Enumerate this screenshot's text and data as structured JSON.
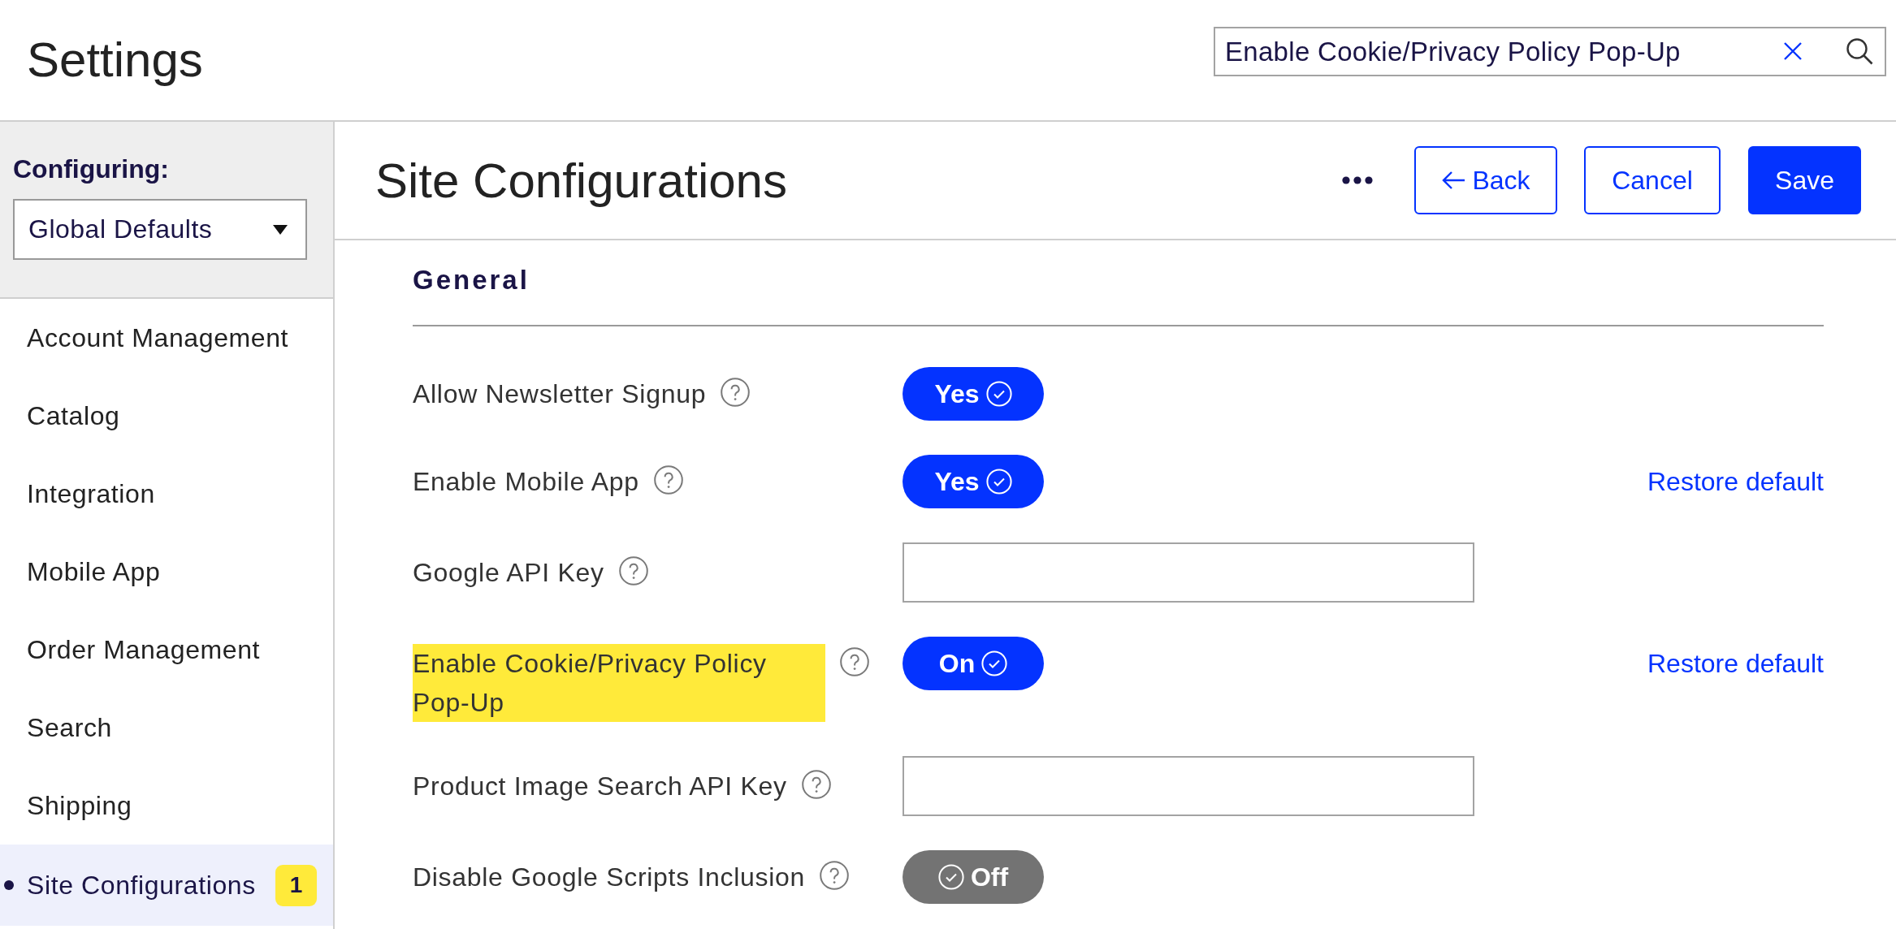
{
  "header": {
    "title": "Settings",
    "search": {
      "value": "Enable Cookie/Privacy Policy Pop-Up"
    }
  },
  "sidebar": {
    "configuring_label": "Configuring:",
    "scope_dropdown": {
      "value": "Global Defaults"
    },
    "items": [
      {
        "label": "Account Management",
        "selected": false
      },
      {
        "label": "Catalog",
        "selected": false
      },
      {
        "label": "Integration",
        "selected": false
      },
      {
        "label": "Mobile App",
        "selected": false
      },
      {
        "label": "Order Management",
        "selected": false
      },
      {
        "label": "Search",
        "selected": false
      },
      {
        "label": "Shipping",
        "selected": false
      },
      {
        "label": "Site Configurations",
        "selected": true,
        "badge": "1"
      }
    ]
  },
  "page": {
    "title": "Site Configurations",
    "actions": [
      {
        "kind": "more"
      },
      {
        "kind": "back",
        "label": "Back"
      },
      {
        "kind": "secondary",
        "label": "Cancel"
      },
      {
        "kind": "primary",
        "label": "Save"
      }
    ]
  },
  "section": {
    "title": "General",
    "rows": [
      {
        "label": "Allow Newsletter Signup",
        "highlighted": false,
        "control": {
          "kind": "toggle",
          "on": true,
          "text": "Yes"
        }
      },
      {
        "label": "Enable Mobile App",
        "highlighted": false,
        "control": {
          "kind": "toggle",
          "on": true,
          "text": "Yes"
        },
        "restore_link": "Restore default"
      },
      {
        "label": "Google API Key",
        "highlighted": false,
        "control": {
          "kind": "input"
        }
      },
      {
        "label": "Enable Cookie/Privacy Policy Pop-Up",
        "highlighted": true,
        "control": {
          "kind": "toggle",
          "on": true,
          "text": "On"
        },
        "restore_link": "Restore default"
      },
      {
        "label": "Product Image Search API Key",
        "highlighted": false,
        "control": {
          "kind": "input"
        }
      },
      {
        "label": "Disable Google Scripts Inclusion",
        "highlighted": false,
        "control": {
          "kind": "toggle",
          "on": false,
          "text": "Off"
        }
      }
    ]
  }
}
